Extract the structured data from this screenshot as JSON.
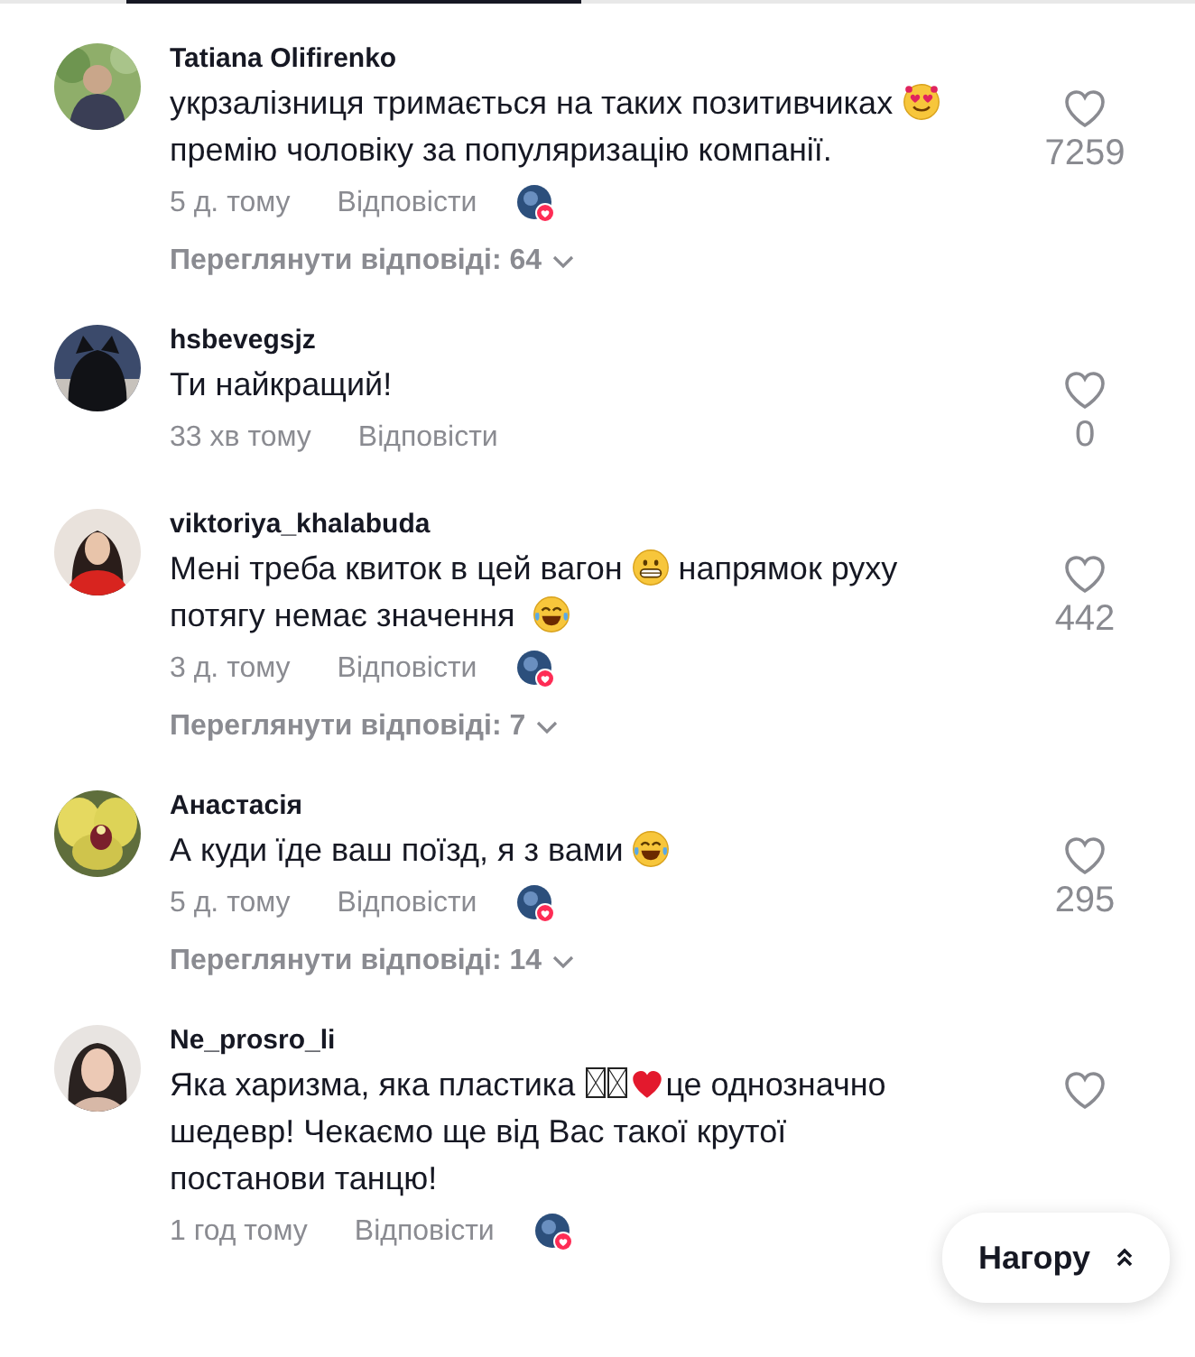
{
  "comments": [
    {
      "author": "Tatiana Olifirenko",
      "segments": [
        {
          "kind": "text",
          "text": "укрзалізниця тримається на таких позитивчиках"
        },
        {
          "kind": "heart-eyes"
        },
        {
          "kind": "text",
          "text": "премію чоловіку за популяризацію компанії."
        }
      ],
      "time": "5 д. тому",
      "reply": "Відповісти",
      "creator_liked": true,
      "likes": "7259",
      "replies": "Переглянути відповіді: 64"
    },
    {
      "author": "hsbevegsjz",
      "segments": [
        {
          "kind": "text",
          "text": "Ти найкращий!"
        }
      ],
      "time": "33 хв тому",
      "reply": "Відповісти",
      "creator_liked": false,
      "likes": "0"
    },
    {
      "author": "viktoriya_khalabuda",
      "segments": [
        {
          "kind": "text",
          "text": "Мені треба квиток в цей вагон"
        },
        {
          "kind": "grin"
        },
        {
          "kind": "text",
          "text": " напрямок руху"
        },
        {
          "kind": "text",
          "text": "потягу немає значення "
        },
        {
          "kind": "joy"
        }
      ],
      "time": "3 д. тому",
      "reply": "Відповісти",
      "creator_liked": true,
      "likes": "442",
      "replies": "Переглянути відповіді: 7"
    },
    {
      "author": "Анастасія",
      "segments": [
        {
          "kind": "text",
          "text": "А куди їде ваш поїзд, я з вами"
        },
        {
          "kind": "joy"
        }
      ],
      "time": "5 д. тому",
      "reply": "Відповісти",
      "creator_liked": true,
      "likes": "295",
      "replies": "Переглянути відповіді: 14"
    },
    {
      "author": "Ne_prosro_li",
      "segments": [
        {
          "kind": "text",
          "text": "Яка харизма, яка пластика"
        },
        {
          "kind": "missing-glyph"
        },
        {
          "kind": "heart"
        },
        {
          "kind": "text",
          "text": "це однозначно"
        },
        {
          "kind": "text",
          "text": "шедевр! Чекаємо ще від Вас такої крутої"
        },
        {
          "kind": "text",
          "text": "постанови танцю!"
        }
      ],
      "time": "1 год тому",
      "reply": "Відповісти",
      "creator_liked": true
    }
  ],
  "scroll_top_button": "Нагору"
}
